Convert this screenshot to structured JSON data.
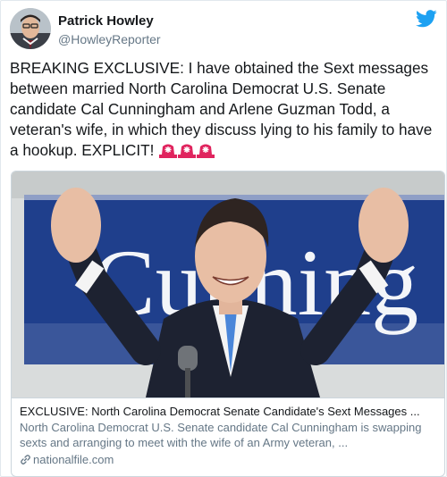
{
  "author": {
    "display_name": "Patrick Howley",
    "handle": "@HowleyReporter"
  },
  "tweet": {
    "text": "BREAKING EXCLUSIVE: I have obtained the Sext messages between married North Carolina Democrat U.S. Senate candidate Cal Cunningham and Arlene Guzman Todd, a veteran's wife, in which they discuss lying to his family to have a hookup. EXPLICIT!",
    "emoji": [
      "police-car-light",
      "police-car-light",
      "police-car-light"
    ]
  },
  "card": {
    "title": "EXCLUSIVE: North Carolina Democrat Senate Candidate's Sext Messages ...",
    "description": "North Carolina Democrat U.S. Senate candidate Cal Cunningham is swapping sexts and arranging to meet with the wife of an Army veteran, ...",
    "domain": "nationalfile.com",
    "banner_text": "Cunning"
  },
  "colors": {
    "twitter_blue": "#1da1f2",
    "banner_blue": "#1f3f8c",
    "siren_red": "#e0245e"
  },
  "icons": [
    "twitter-bird-icon",
    "link-icon",
    "siren-icon"
  ]
}
